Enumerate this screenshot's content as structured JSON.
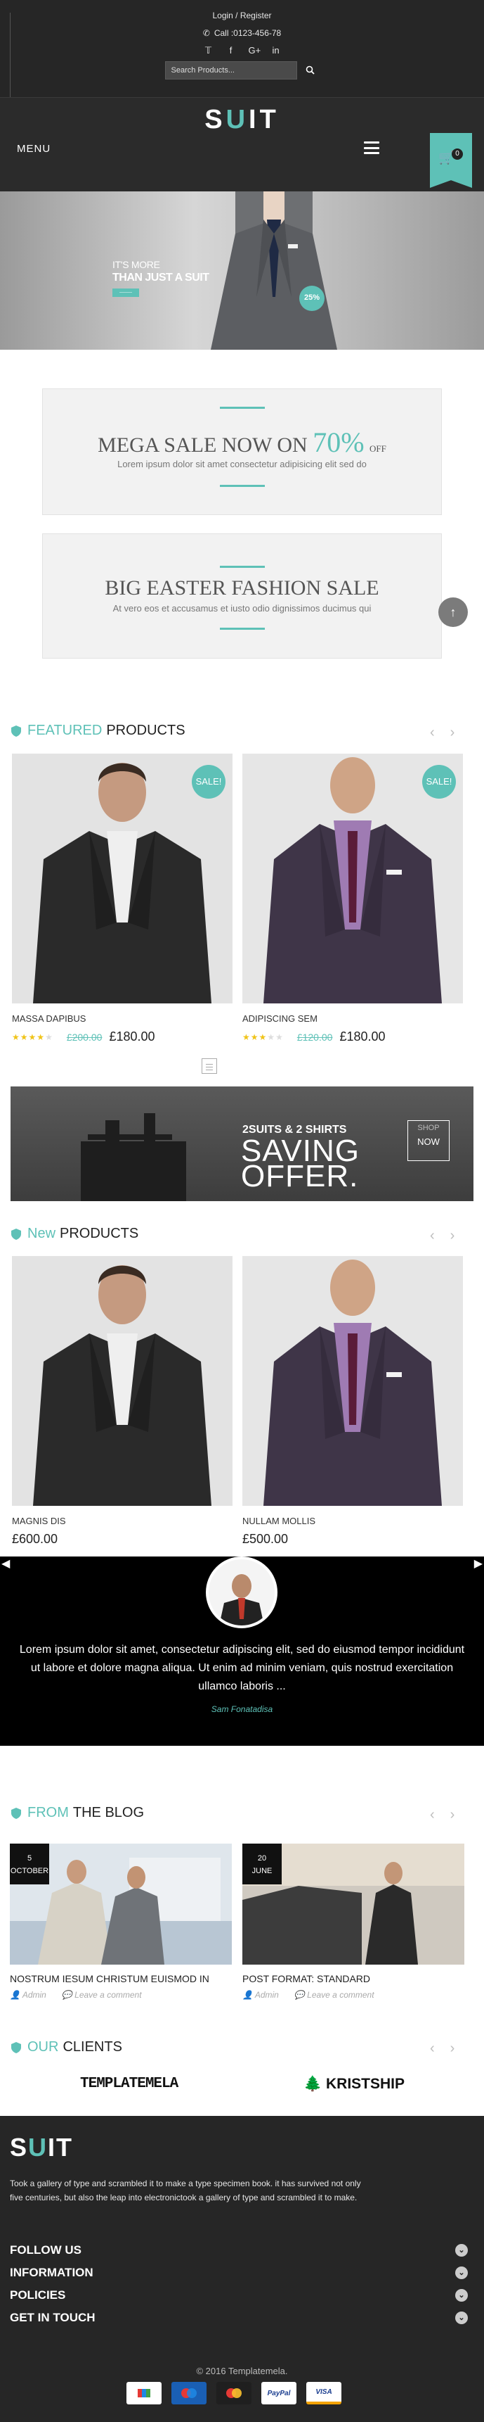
{
  "topbar": {
    "login_link": "Login / Register",
    "call": "Call :0123-456-78",
    "social": [
      "twitter-icon",
      "facebook-icon",
      "googleplus-icon",
      "linkedin-icon"
    ],
    "social_glyphs": [
      "🐦",
      "f",
      "G+",
      "in"
    ],
    "search_placeholder": "Search Products..."
  },
  "header": {
    "logo_s": "S",
    "logo_u": "U",
    "logo_it": "IT",
    "menu_label": "MENU",
    "cart_count": "0"
  },
  "banner": {
    "line1": "IT'S MORE",
    "line2": "THAN JUST A SUIT",
    "badge": "25%"
  },
  "promos": [
    {
      "title": "MEGA SALE NOW ON",
      "percent": "70%",
      "off": "OFF",
      "sub": "Lorem ipsum dolor sit amet consectetur adipisicing elit sed do"
    },
    {
      "title": "BIG EASTER FASHION SALE",
      "sub": "At vero eos et accusamus et iusto odio dignissimos ducimus qui"
    }
  ],
  "featured": {
    "accent": "FEATURED",
    "title": "PRODUCTS",
    "products": [
      {
        "name": "MASSA DAPIBUS",
        "rating": 3.5,
        "old_price": "£200.00",
        "price": "£180.00",
        "sale": "SALE!"
      },
      {
        "name": "ADIPISCING SEM",
        "rating": 2.5,
        "old_price": "£120.00",
        "price": "£180.00",
        "sale": "SALE!"
      }
    ]
  },
  "offer": {
    "line1": "2SUITS  & 2 SHIRTS",
    "line2a": "SAVING",
    "line2b": "OFFER.",
    "shop_top": "SHOP",
    "shop_bottom": "NOW"
  },
  "new_products": {
    "accent": "New",
    "title": "PRODUCTS",
    "products": [
      {
        "name": "MAGNIS DIS",
        "price": "£600.00"
      },
      {
        "name": "NULLAM MOLLIS",
        "price": "£500.00"
      }
    ]
  },
  "testimonial": {
    "quote": "Lorem ipsum dolor sit amet, consectetur adipiscing elit, sed do eiusmod tempor incididunt ut labore et dolore magna aliqua. Ut enim ad minim veniam, quis nostrud exercitation ullamco laboris ...",
    "author": "Sam Fonatadisa"
  },
  "blog": {
    "accent": "FROM",
    "title": "THE BLOG",
    "posts": [
      {
        "day": "5",
        "month": "OCTOBER",
        "title": "NOSTRUM IESUM CHRISTUM EUISMOD IN",
        "author": "Admin",
        "comment": "Leave a comment"
      },
      {
        "day": "20",
        "month": "JUNE",
        "title": "POST FORMAT: STANDARD",
        "author": "Admin",
        "comment": "Leave a comment"
      }
    ]
  },
  "clients": {
    "accent": "OUR",
    "title": "CLIENTS",
    "logos": [
      "TEMPLATEMELA",
      "KRISTSHIP"
    ]
  },
  "footer": {
    "about": "Took a gallery of type and scrambled it to make a type specimen book. it has survived not only five centuries, but also the leap into electronictook a gallery of type and scrambled it to make.",
    "links": [
      "FOLLOW US",
      "INFORMATION",
      "POLICIES",
      "GET IN TOUCH"
    ],
    "copyright": "© 2016 Templatemela.",
    "payments": [
      "",
      "",
      "",
      "PayPal",
      "VISA"
    ]
  },
  "colors": {
    "accent": "#5ec1b7",
    "dark": "#262626"
  }
}
